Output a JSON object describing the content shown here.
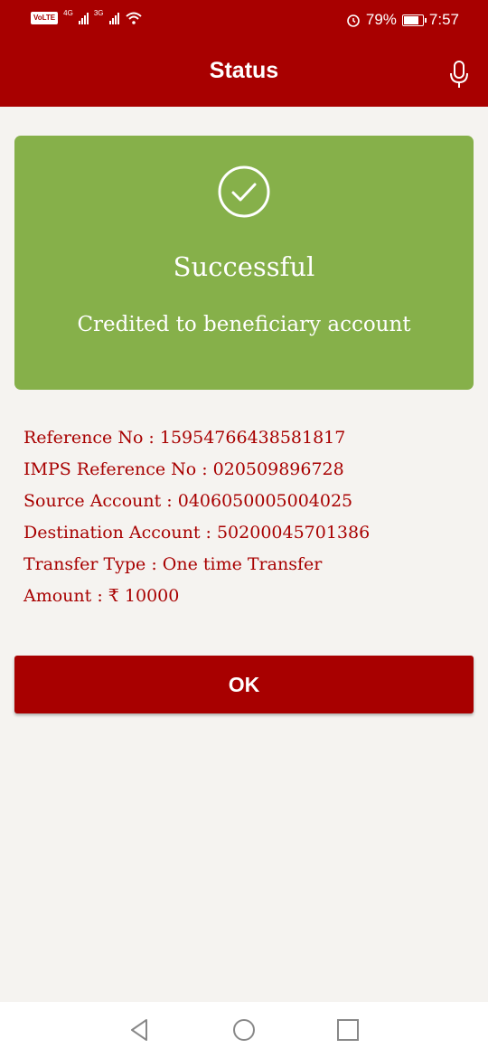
{
  "status_bar": {
    "volte": "VoLTE",
    "network_1": "4G",
    "network_2": "3G",
    "battery_percent": "79%",
    "time": "7:57"
  },
  "appbar": {
    "title": "Status",
    "icon": "microphone-icon"
  },
  "result": {
    "icon": "check-circle-icon",
    "heading": "Successful",
    "message": "Credited to beneficiary account",
    "color": "#86b04a"
  },
  "details": [
    "Reference No : 15954766438581817",
    "IMPS Reference No : 020509896728",
    "Source Account : 0406050005004025",
    "Destination Account : 50200045701386",
    "Transfer Type : One time Transfer",
    "Amount : ₹ 10000"
  ],
  "ok_button": {
    "label": "OK"
  },
  "colors": {
    "primary": "#a80000",
    "background": "#f5f3f0",
    "success": "#86b04a"
  },
  "nav_icons": [
    "back-icon",
    "home-icon",
    "recents-icon"
  ]
}
